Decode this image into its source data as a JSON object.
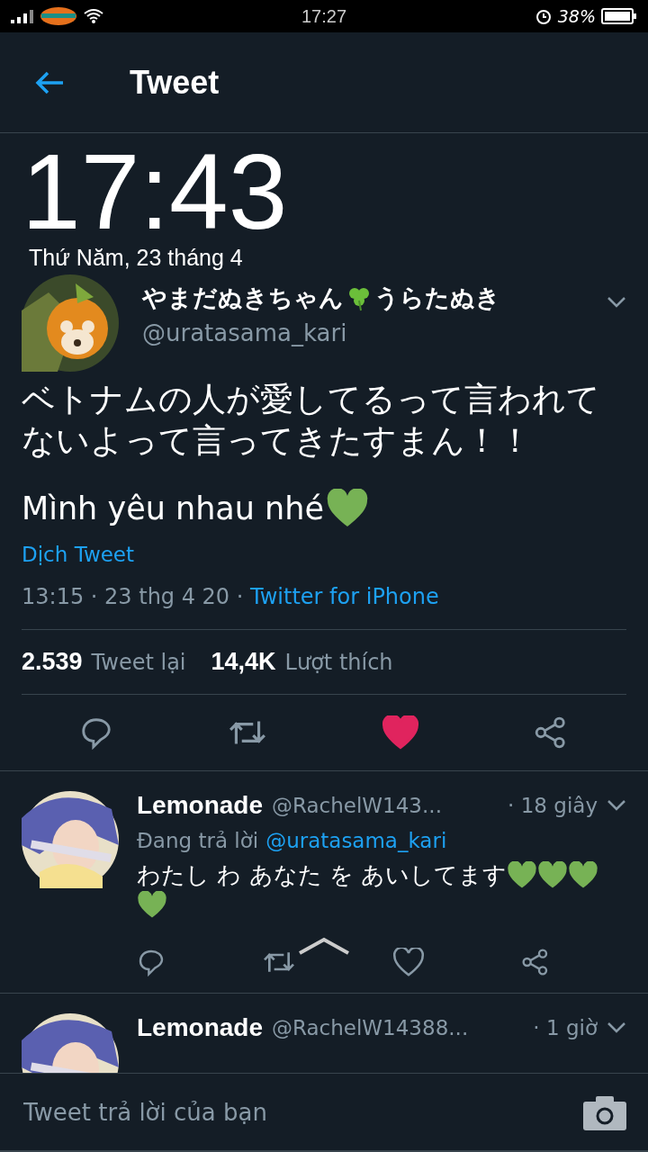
{
  "status_bar": {
    "time": "17:27",
    "battery": "38%"
  },
  "lock_overlay": {
    "time": "17:43",
    "date": "Thứ Năm, 23 tháng 4"
  },
  "header": {
    "title": "Tweet"
  },
  "tweet": {
    "name_before": "やまだぬきちゃん",
    "name_after": "うらたぬき",
    "handle": "@uratasama_kari",
    "text": "ベトナムの人が愛してるって言われてないよって言ってきたすまん！！",
    "text2": "Mình yêu nhau nhé",
    "translate": "Dịch Tweet",
    "timestamp": "13:15 · 23 thg 4 20 · ",
    "source": "Twitter for iPhone",
    "retweets": "2.539",
    "retweets_label": "Tweet lại",
    "likes": "14,4K",
    "likes_label": "Lượt thích",
    "liked": true
  },
  "replies": [
    {
      "name": "Lemonade",
      "handle": "@RachelW143...",
      "time": "· 18 giây",
      "replying_label": "Đang trả lời",
      "replying_to": "@uratasama_kari",
      "text": "わたし わ あなた を あいしてます",
      "emoji": [
        {
          "kind": "green_heart"
        },
        {
          "kind": "green_heart"
        },
        {
          "kind": "green_heart"
        },
        {
          "kind": "green_heart"
        }
      ],
      "liked": false
    },
    {
      "name": "Lemonade",
      "handle": "@RachelW14388...",
      "time": "· 1 giờ"
    }
  ],
  "composer": {
    "placeholder": "Tweet trả lời của bạn"
  }
}
